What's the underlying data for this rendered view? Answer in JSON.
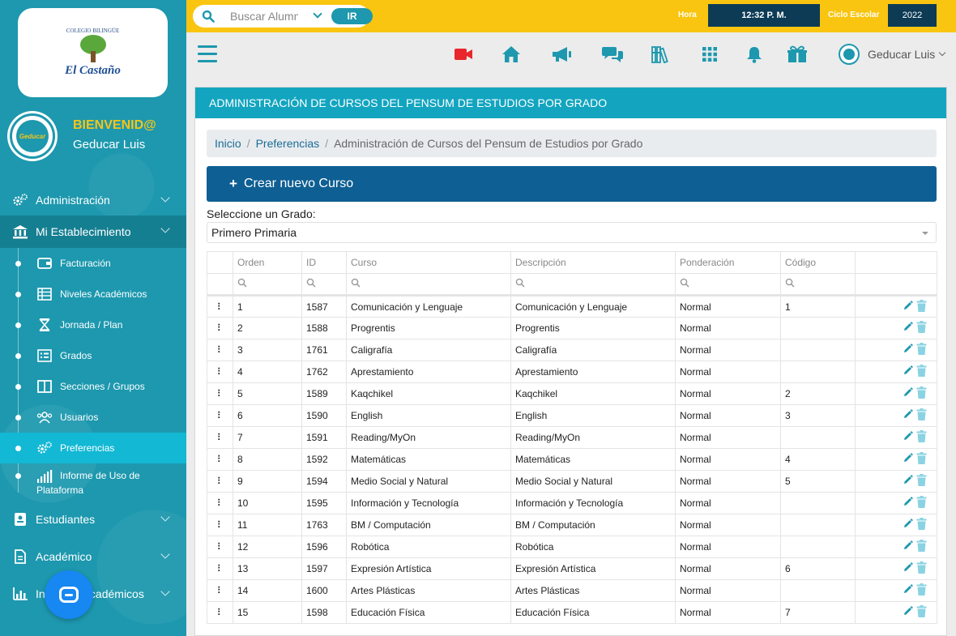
{
  "school": {
    "arc_text": "COLEGIO BILINGÜE",
    "name": "El Castaño",
    "avatar_text": "Geducar"
  },
  "user": {
    "welcome": "BIENVENID@",
    "name": "Geducar Luis"
  },
  "topbar": {
    "search_placeholder": "Buscar Alumnos",
    "go_label": "IR",
    "hora_label": "Hora",
    "time": "12:32 P. M.",
    "ciclo_label": "Ciclo Escolar",
    "year": "2022"
  },
  "iconbar": {
    "icons": [
      "video-icon",
      "home-icon",
      "megaphone-icon",
      "chat-icon",
      "books-icon",
      "apps-grid-icon",
      "bell-icon",
      "gift-icon"
    ],
    "user_name": "Geducar Luis"
  },
  "nav": {
    "items": [
      {
        "label": "Administración",
        "icon": "gears-icon"
      },
      {
        "label": "Mi Establecimiento",
        "icon": "institution-icon"
      }
    ],
    "subitems": [
      {
        "label": "Facturación",
        "icon": "wallet-icon"
      },
      {
        "label": "Niveles Académicos",
        "icon": "table-icon"
      },
      {
        "label": "Jornada / Plan",
        "icon": "hourglass-icon"
      },
      {
        "label": "Grados",
        "icon": "list-icon"
      },
      {
        "label": "Secciones / Grupos",
        "icon": "columns-icon"
      },
      {
        "label": "Usuarios",
        "icon": "users-icon"
      },
      {
        "label": "Preferencias",
        "icon": "gears-icon"
      },
      {
        "label": "Informe de Uso de Plataforma",
        "icon": "signal-bars-icon"
      }
    ],
    "bottom_items": [
      {
        "label": "Estudiantes",
        "icon": "student-card-icon"
      },
      {
        "label": "Académico",
        "icon": "document-icon"
      },
      {
        "label": "Informes Académicos",
        "icon": "bar-chart-icon"
      }
    ]
  },
  "colors": {
    "sidebar": "#1d98ae",
    "active": "#13b8d4",
    "topbar": "#f9c510",
    "header": "#13a5c0",
    "primary_button": "#0e5f93"
  },
  "card": {
    "title": "ADMINISTRACIÓN DE CURSOS DEL PENSUM DE ESTUDIOS POR GRADO",
    "breadcrumb": [
      "Inicio",
      "Preferencias",
      "Administración de Cursos del Pensum de Estudios por Grado"
    ],
    "create_label": "Crear nuevo Curso",
    "grade_label": "Seleccione un Grado:",
    "grade_value": "Primero Primaria"
  },
  "table": {
    "columns": [
      "Orden",
      "ID",
      "Curso",
      "Descripción",
      "Ponderación",
      "Código"
    ],
    "rows": [
      [
        "1",
        "1587",
        "Comunicación y Lenguaje",
        "Comunicación y Lenguaje",
        "Normal",
        "1"
      ],
      [
        "2",
        "1588",
        "Progrentis",
        "Progrentis",
        "Normal",
        ""
      ],
      [
        "3",
        "1761",
        "Caligrafía",
        "Caligrafía",
        "Normal",
        ""
      ],
      [
        "4",
        "1762",
        "Aprestamiento",
        "Aprestamiento",
        "Normal",
        ""
      ],
      [
        "5",
        "1589",
        "Kaqchikel",
        "Kaqchikel",
        "Normal",
        "2"
      ],
      [
        "6",
        "1590",
        "English",
        "English",
        "Normal",
        "3"
      ],
      [
        "7",
        "1591",
        "Reading/MyOn",
        "Reading/MyOn",
        "Normal",
        ""
      ],
      [
        "8",
        "1592",
        "Matemáticas",
        "Matemáticas",
        "Normal",
        "4"
      ],
      [
        "9",
        "1594",
        "Medio Social y Natural",
        "Medio Social y Natural",
        "Normal",
        "5"
      ],
      [
        "10",
        "1595",
        "Información y Tecnología",
        "Información y Tecnología",
        "Normal",
        ""
      ],
      [
        "11",
        "1763",
        "BM / Computación",
        "BM / Computación",
        "Normal",
        ""
      ],
      [
        "12",
        "1596",
        "Robótica",
        "Robótica",
        "Normal",
        ""
      ],
      [
        "13",
        "1597",
        "Expresión Artística",
        "Expresión Artística",
        "Normal",
        "6"
      ],
      [
        "14",
        "1600",
        "Artes Plásticas",
        "Artes Plásticas",
        "Normal",
        ""
      ],
      [
        "15",
        "1598",
        "Educación Física",
        "Educación Física",
        "Normal",
        "7"
      ]
    ]
  }
}
